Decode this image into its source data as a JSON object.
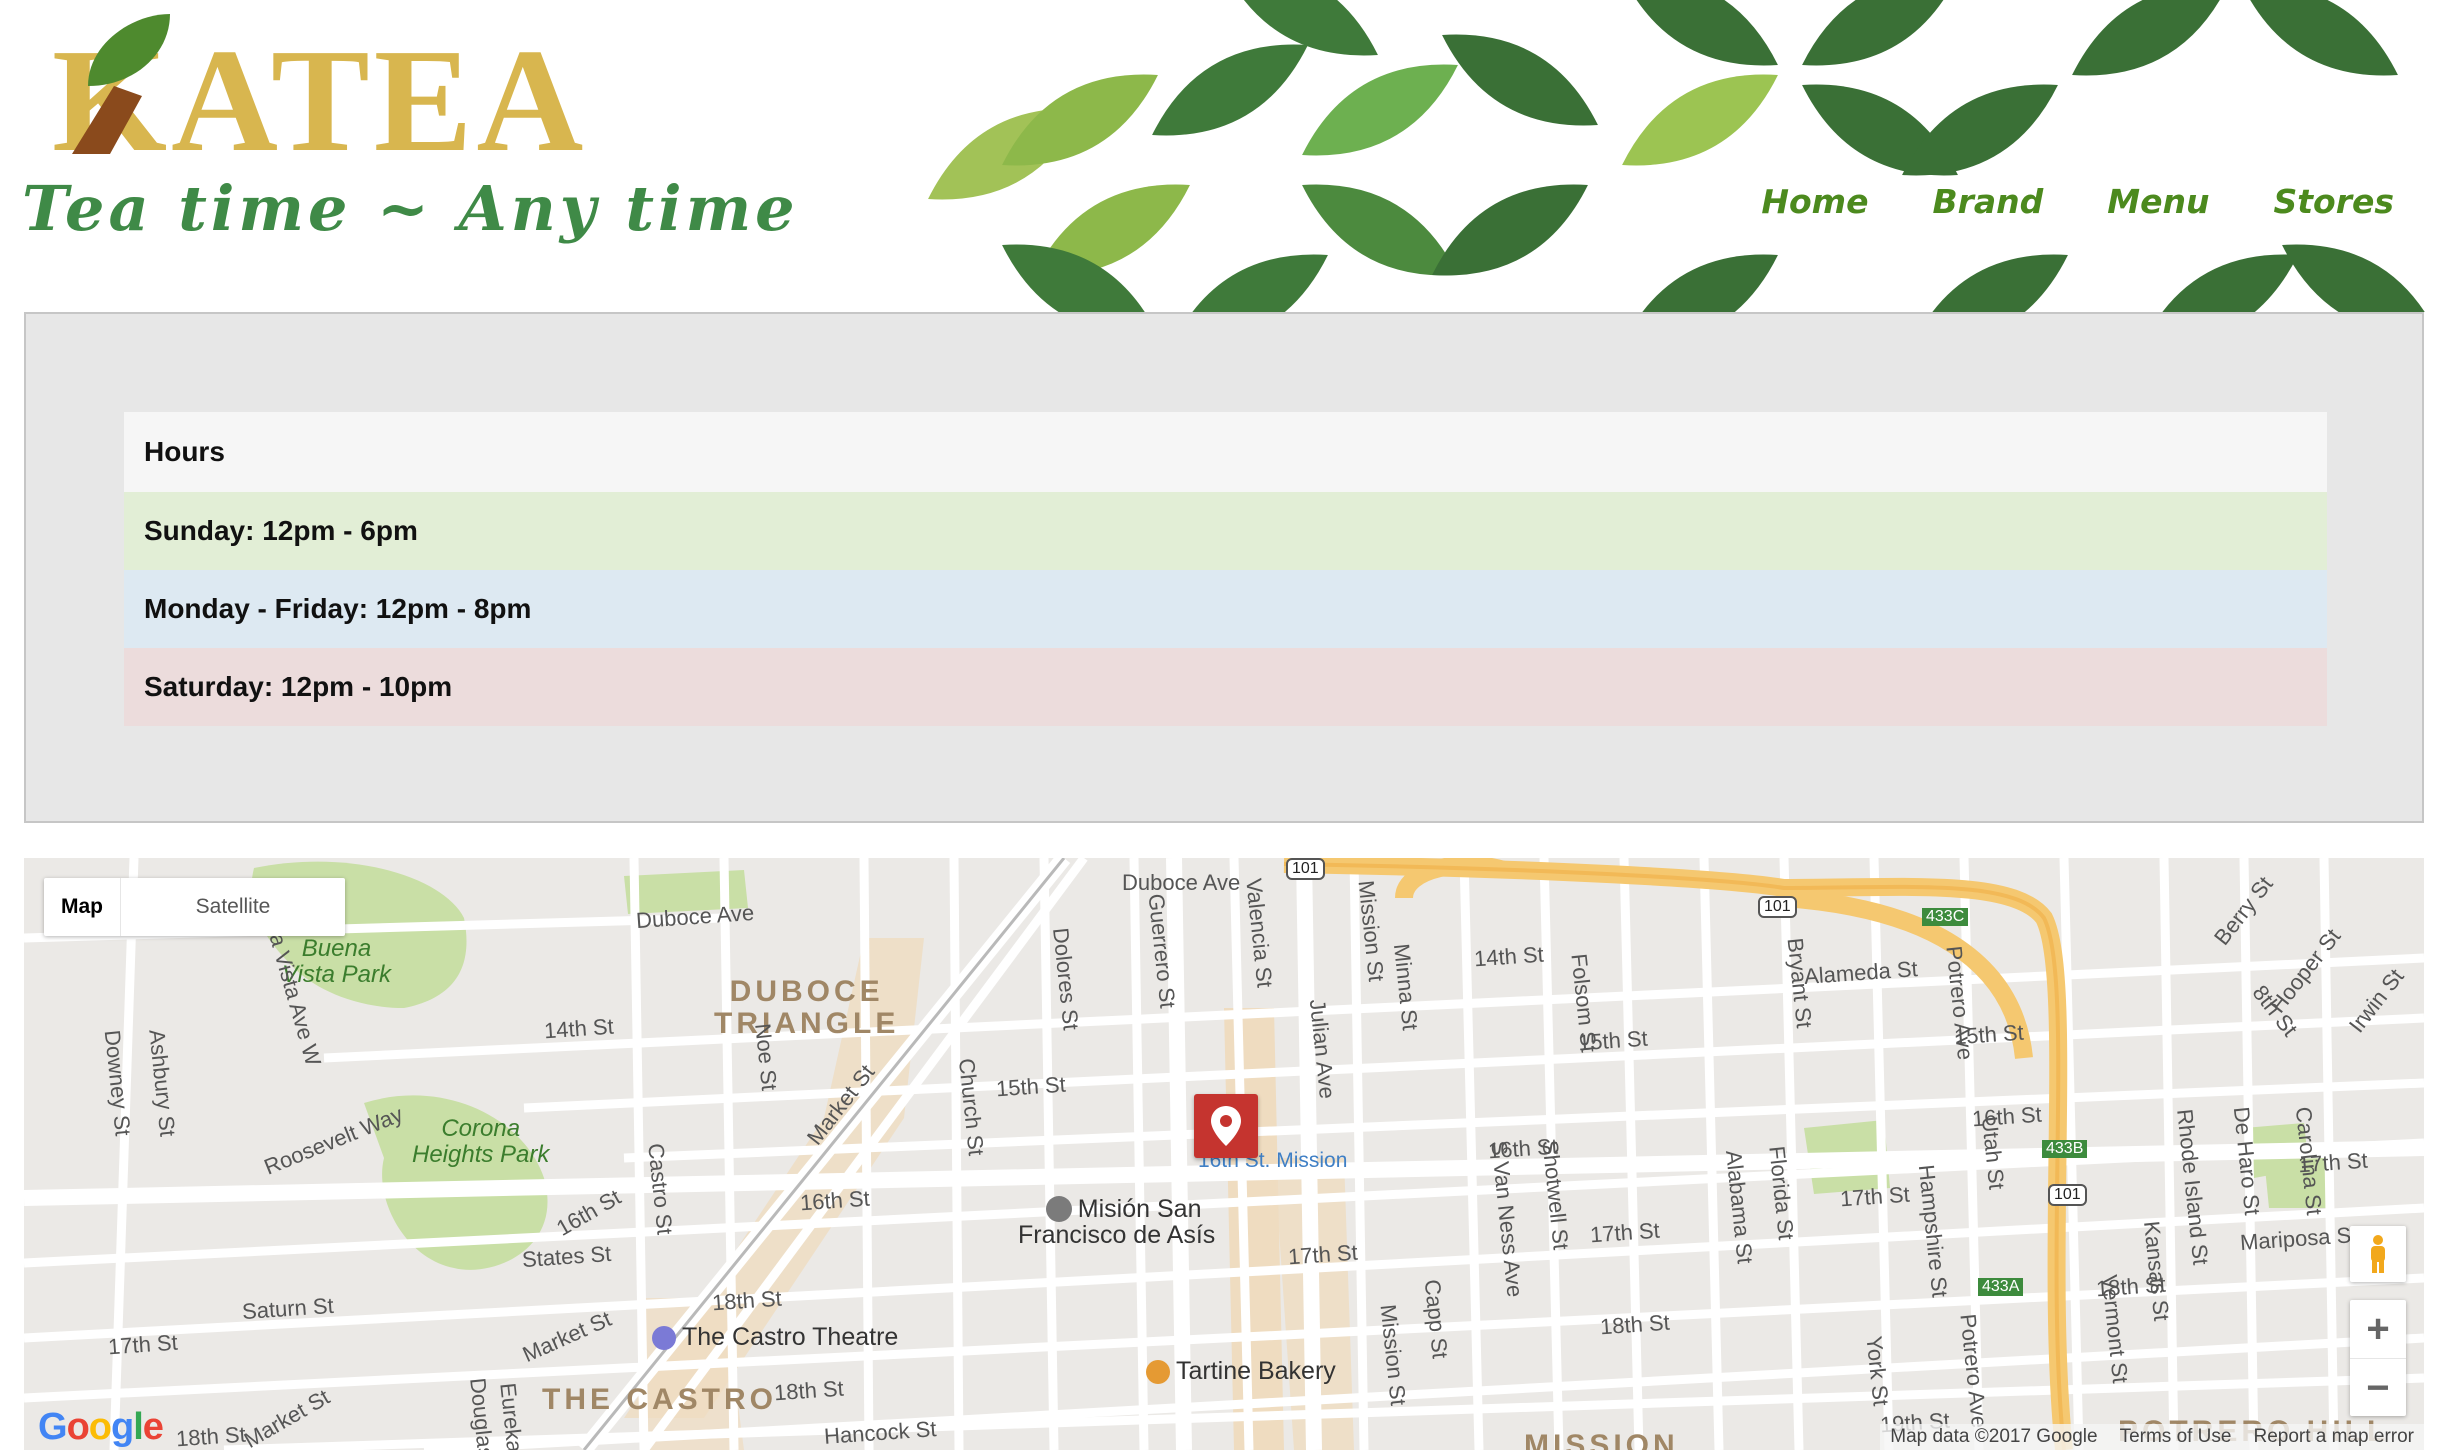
{
  "header": {
    "logo_text": "KATEA",
    "tagline": "Tea time ~ Any time",
    "nav": [
      "Home",
      "Brand",
      "Menu",
      "Stores"
    ]
  },
  "hours": {
    "heading": "Hours",
    "rows": [
      "Sunday: 12pm - 6pm",
      "Monday - Friday: 12pm - 8pm",
      "Saturday: 12pm - 10pm"
    ]
  },
  "map": {
    "type_buttons": [
      "Map",
      "Satellite"
    ],
    "zoom_in": "+",
    "zoom_out": "−",
    "google": "Google",
    "attribution": [
      "Map data ©2017 Google",
      "Terms of Use",
      "Report a map error"
    ],
    "neighborhoods": [
      "DUBOCE\nTRIANGLE",
      "THE CASTRO",
      "MISSION",
      "POTRERO HILL"
    ],
    "parks": [
      "Buena\nVista Park",
      "Corona\nHeights Park"
    ],
    "pois": [
      "Misión San\nFrancisco de Asís",
      "The Castro Theatre",
      "Tartine Bakery",
      "16th St. Mission"
    ],
    "streets": [
      "Duboce Ave",
      "Duboce Ave",
      "14th St",
      "14th St",
      "15th St",
      "15th St",
      "15th St",
      "16th St",
      "16th St",
      "16th St",
      "16th St",
      "17th St",
      "17th St",
      "17th St",
      "17th St",
      "17th St",
      "18th St",
      "18th St",
      "18th St",
      "18th St",
      "19th St",
      "Market St",
      "Market St",
      "Market St",
      "Market St",
      "Roosevelt Way",
      "States St",
      "Saturn St",
      "Hancock St",
      "Alameda St",
      "Mariposa St",
      "Dolores St",
      "Guerrero St",
      "Valencia St",
      "Mission St",
      "Mission St",
      "Minna St",
      "Julian Ave",
      "Capp St",
      "S Van Ness Ave",
      "Shotwell St",
      "Folsom St",
      "Alabama St",
      "Florida St",
      "Bryant St",
      "Potrero Ave",
      "Potrero Ave",
      "Hampshire St",
      "York St",
      "Utah St",
      "Kansas St",
      "Vermont St",
      "Rhode Island St",
      "De Haro St",
      "Carolina St",
      "Hooper St",
      "Irwin St",
      "8th St",
      "Berry St",
      "Noe St",
      "Church St",
      "Castro St",
      "Ashbury St",
      "Downey St",
      "Buena Vista Ave W",
      "Eureka St",
      "Douglass St"
    ],
    "highway_shields": [
      "101",
      "101",
      "101",
      "433C",
      "433B",
      "433A"
    ]
  },
  "colors": {
    "nav": "#4c8a1e",
    "tagline": "#3f8a47",
    "logo_gold": "#d8b64f",
    "marker": "#c5342f",
    "row_sunday": "#e2eed6",
    "row_weekday": "#dde9f2",
    "row_saturday": "#ecdcdc"
  }
}
